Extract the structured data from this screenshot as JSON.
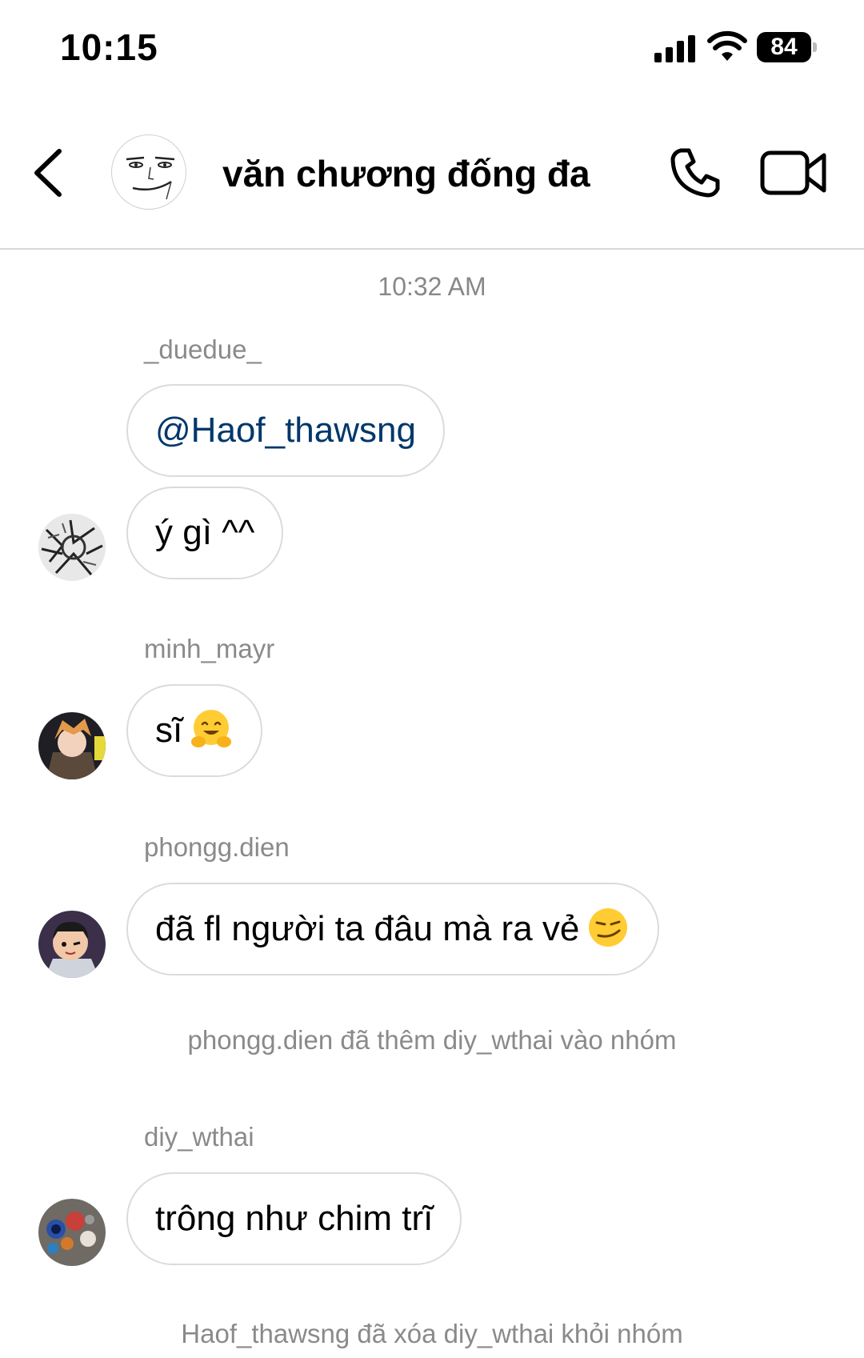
{
  "status_bar": {
    "time": "10:15",
    "battery": "84"
  },
  "header": {
    "title": "văn chương đống đa"
  },
  "chat": {
    "timestamp": "10:32 AM",
    "groups": [
      {
        "sender": "_duedue_",
        "messages": [
          "@Haof_thawsng",
          "ý gì ^^"
        ]
      },
      {
        "sender": "minh_mayr",
        "messages": [
          "sĩ"
        ]
      },
      {
        "sender": "phongg.dien",
        "messages": [
          "đã fl người ta đâu mà ra vẻ"
        ]
      },
      {
        "sender": "diy_wthai",
        "messages": [
          "trông như chim trĩ"
        ]
      }
    ],
    "system_messages": [
      "phongg.dien đã thêm diy_wthai vào nhóm",
      "Haof_thawsng đã xóa diy_wthai khỏi nhóm"
    ]
  }
}
